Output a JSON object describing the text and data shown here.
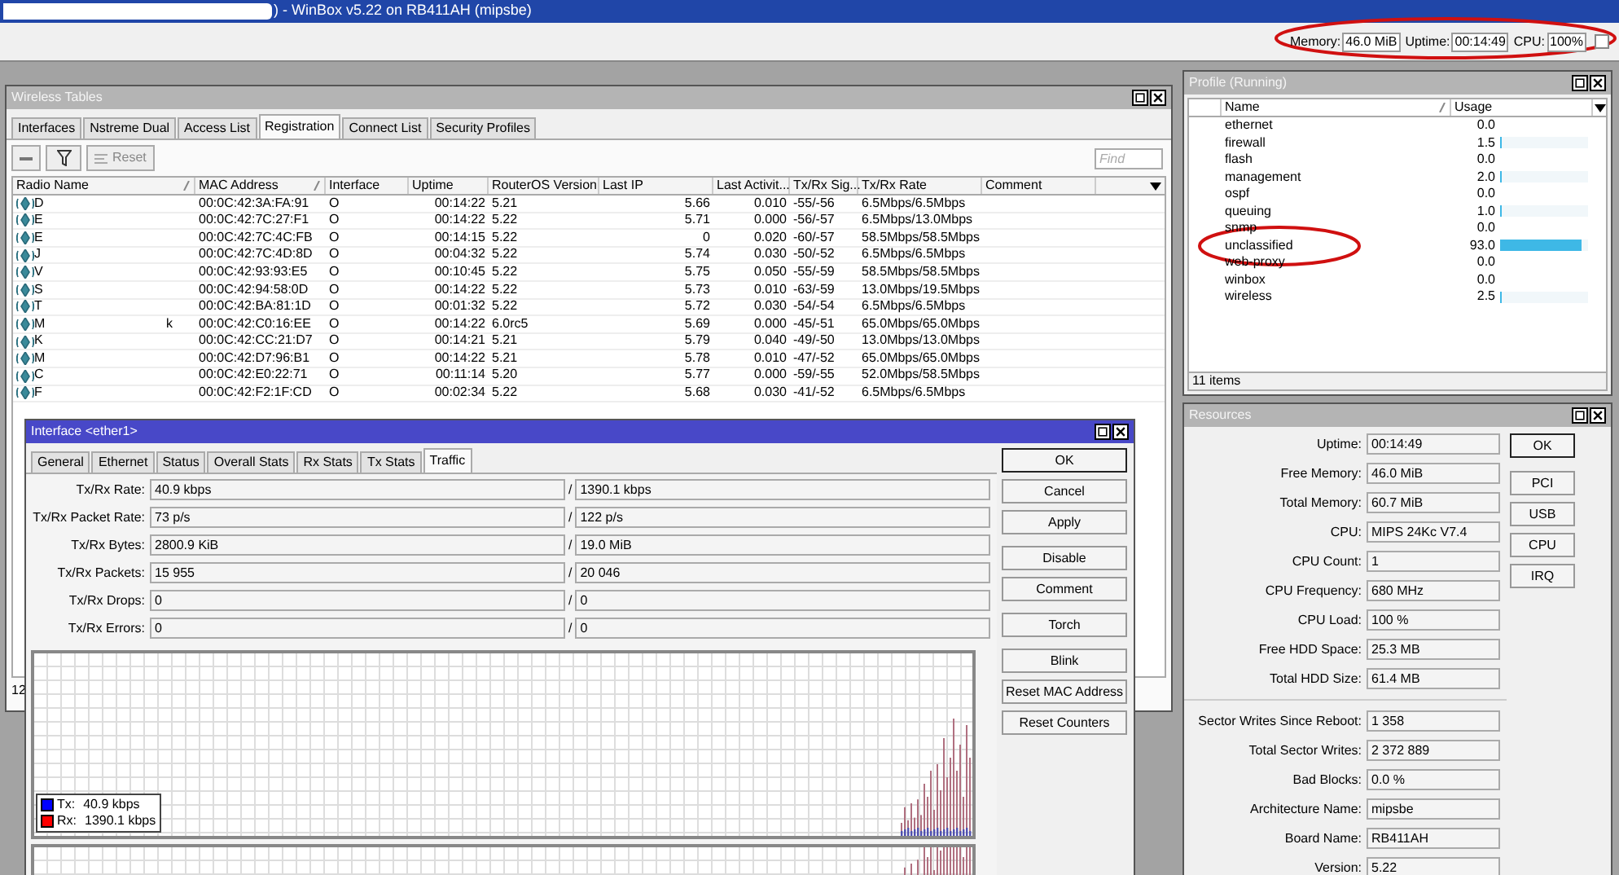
{
  "window": {
    "title": ") - WinBox v5.22 on RB411AH (mipsbe)"
  },
  "status": [
    {
      "label": "Memory:",
      "value": "46.0 MiB"
    },
    {
      "label": "Uptime:",
      "value": "00:14:49"
    },
    {
      "label": "CPU:",
      "value": "100%"
    }
  ],
  "toolbar_checkbox": {
    "checked": false
  },
  "wireless_tables": {
    "title": "Wireless Tables",
    "tabs": [
      {
        "label": "Interfaces",
        "selected": false
      },
      {
        "label": "Nstreme Dual",
        "selected": false
      },
      {
        "label": "Access List",
        "selected": false
      },
      {
        "label": "Registration",
        "selected": true
      },
      {
        "label": "Connect List",
        "selected": false
      },
      {
        "label": "Security Profiles",
        "selected": false
      }
    ],
    "reset": "Reset",
    "find_placeholder": "Find",
    "columns": [
      "Radio Name",
      "MAC Address",
      "Interface",
      "Uptime",
      "RouterOS Version",
      "Last IP",
      "Last Activit...",
      "Tx/Rx Sig...",
      "Tx/Rx Rate",
      "Comment"
    ],
    "rows": [
      {
        "cells": [
          "D",
          "00:0C:42:3A:FA:91",
          "O",
          "00:14:22",
          "5.21",
          "5.66",
          "0.010",
          "-55/-56",
          "6.5Mbps/6.5Mbps"
        ]
      },
      {
        "cells": [
          "E",
          "00:0C:42:7C:27:F1",
          "O",
          "00:14:22",
          "5.22",
          "5.71",
          "0.000",
          "-56/-57",
          "6.5Mbps/13.0Mbps"
        ]
      },
      {
        "cells": [
          "E",
          "00:0C:42:7C:4C:FB",
          "O",
          "00:14:15",
          "5.22",
          "0",
          "0.020",
          "-60/-57",
          "58.5Mbps/58.5Mbps"
        ]
      },
      {
        "cells": [
          "J",
          "00:0C:42:7C:4D:8D",
          "O",
          "00:04:32",
          "5.22",
          "5.74",
          "0.030",
          "-50/-52",
          "6.5Mbps/6.5Mbps"
        ]
      },
      {
        "cells": [
          "V",
          "00:0C:42:93:93:E5",
          "O",
          "00:10:45",
          "5.22",
          "5.75",
          "0.050",
          "-55/-59",
          "58.5Mbps/58.5Mbps"
        ]
      },
      {
        "cells": [
          "S",
          "00:0C:42:94:58:0D",
          "O",
          "00:14:22",
          "5.22",
          "5.73",
          "0.010",
          "-63/-59",
          "13.0Mbps/19.5Mbps"
        ]
      },
      {
        "cells": [
          "T",
          "00:0C:42:BA:81:1D",
          "O",
          "00:01:32",
          "5.22",
          "5.72",
          "0.030",
          "-54/-54",
          "6.5Mbps/6.5Mbps"
        ]
      },
      {
        "cells": [
          "M",
          "00:0C:42:C0:16:EE",
          "O",
          "00:14:22",
          "6.0rc5",
          "5.69",
          "0.000",
          "-45/-51",
          "65.0Mbps/65.0Mbps"
        ],
        "name_tail": "k"
      },
      {
        "cells": [
          "K",
          "00:0C:42:CC:21:D7",
          "O",
          "00:14:21",
          "5.21",
          "5.79",
          "0.040",
          "-49/-50",
          "13.0Mbps/13.0Mbps"
        ]
      },
      {
        "cells": [
          "M",
          "00:0C:42:D7:96:B1",
          "O",
          "00:14:22",
          "5.21",
          "5.78",
          "0.010",
          "-47/-52",
          "65.0Mbps/65.0Mbps"
        ]
      },
      {
        "cells": [
          "C",
          "00:0C:42:E0:22:71",
          "O",
          "00:11:14",
          "5.20",
          "5.77",
          "0.000",
          "-59/-55",
          "52.0Mbps/58.5Mbps"
        ]
      },
      {
        "cells": [
          "F",
          "00:0C:42:F2:1F:CD",
          "O",
          "00:02:34",
          "5.22",
          "5.68",
          "0.030",
          "-41/-52",
          "6.5Mbps/6.5Mbps"
        ]
      }
    ],
    "footer": "12"
  },
  "interface_window": {
    "title": "Interface <ether1>",
    "tabs": [
      {
        "label": "General",
        "selected": false
      },
      {
        "label": "Ethernet",
        "selected": false
      },
      {
        "label": "Status",
        "selected": false
      },
      {
        "label": "Overall Stats",
        "selected": false
      },
      {
        "label": "Rx Stats",
        "selected": false
      },
      {
        "label": "Tx Stats",
        "selected": false
      },
      {
        "label": "Traffic",
        "selected": true
      }
    ],
    "stats": [
      {
        "label": "Tx/Rx Rate:",
        "tx": "40.9 kbps",
        "sep": "/",
        "rx": "1390.1 kbps"
      },
      {
        "label": "Tx/Rx Packet Rate:",
        "tx": "73 p/s",
        "sep": "/",
        "rx": "122 p/s"
      },
      {
        "label": "Tx/Rx Bytes:",
        "tx": "2800.9 KiB",
        "sep": "/",
        "rx": "19.0 MiB"
      },
      {
        "label": "Tx/Rx Packets:",
        "tx": "15 955",
        "sep": "/",
        "rx": "20 046"
      },
      {
        "label": "Tx/Rx Drops:",
        "tx": "0",
        "sep": "/",
        "rx": "0"
      },
      {
        "label": "Tx/Rx Errors:",
        "tx": "0",
        "sep": "/",
        "rx": "0"
      }
    ],
    "legend": [
      {
        "label": "Tx:",
        "value": "40.9 kbps",
        "color": "#0000ff"
      },
      {
        "label": "Rx:",
        "value": "1390.1 kbps",
        "color": "#ff0000"
      }
    ],
    "buttons": [
      "OK",
      "Cancel",
      "Apply",
      "Disable",
      "Comment",
      "Torch",
      "Blink",
      "Reset MAC Address",
      "Reset Counters"
    ]
  },
  "profile": {
    "title": "Profile (Running)",
    "columns": [
      "Name",
      "Usage"
    ],
    "rows": [
      {
        "name": "ethernet",
        "usage": "0.0"
      },
      {
        "name": "firewall",
        "usage": "1.5",
        "level": 0.015
      },
      {
        "name": "flash",
        "usage": "0.0"
      },
      {
        "name": "management",
        "usage": "2.0",
        "level": 0.02
      },
      {
        "name": "ospf",
        "usage": "0.0"
      },
      {
        "name": "queuing",
        "usage": "1.0",
        "level": 0.01
      },
      {
        "name": "snmp",
        "usage": "0.0"
      },
      {
        "name": "unclassified",
        "usage": "93.0",
        "level": 0.93
      },
      {
        "name": "web-proxy",
        "usage": "0.0"
      },
      {
        "name": "winbox",
        "usage": "0.0"
      },
      {
        "name": "wireless",
        "usage": "2.5",
        "level": 0.025
      }
    ],
    "footer": "11 items"
  },
  "resources": {
    "title": "Resources",
    "groups": [
      [
        {
          "label": "Uptime:",
          "value": "00:14:49"
        },
        {
          "label": "Free Memory:",
          "value": "46.0 MiB"
        },
        {
          "label": "Total Memory:",
          "value": "60.7 MiB"
        },
        {
          "label": "CPU:",
          "value": "MIPS 24Kc V7.4"
        },
        {
          "label": "CPU Count:",
          "value": "1"
        },
        {
          "label": "CPU Frequency:",
          "value": "680 MHz"
        },
        {
          "label": "CPU Load:",
          "value": "100 %"
        },
        {
          "label": "Free HDD Space:",
          "value": "25.3 MB"
        },
        {
          "label": "Total HDD Size:",
          "value": "61.4 MB"
        }
      ],
      [
        {
          "label": "Sector Writes Since Reboot:",
          "value": "1 358"
        },
        {
          "label": "Total Sector Writes:",
          "value": "2 372 889"
        },
        {
          "label": "Bad Blocks:",
          "value": "0.0 %"
        },
        {
          "label": "Architecture Name:",
          "value": "mipsbe"
        },
        {
          "label": "Board Name:",
          "value": "RB411AH"
        },
        {
          "label": "Version:",
          "value": "5.22"
        }
      ]
    ],
    "buttons": [
      "OK",
      "PCI",
      "USB",
      "CPU",
      "IRQ"
    ]
  }
}
